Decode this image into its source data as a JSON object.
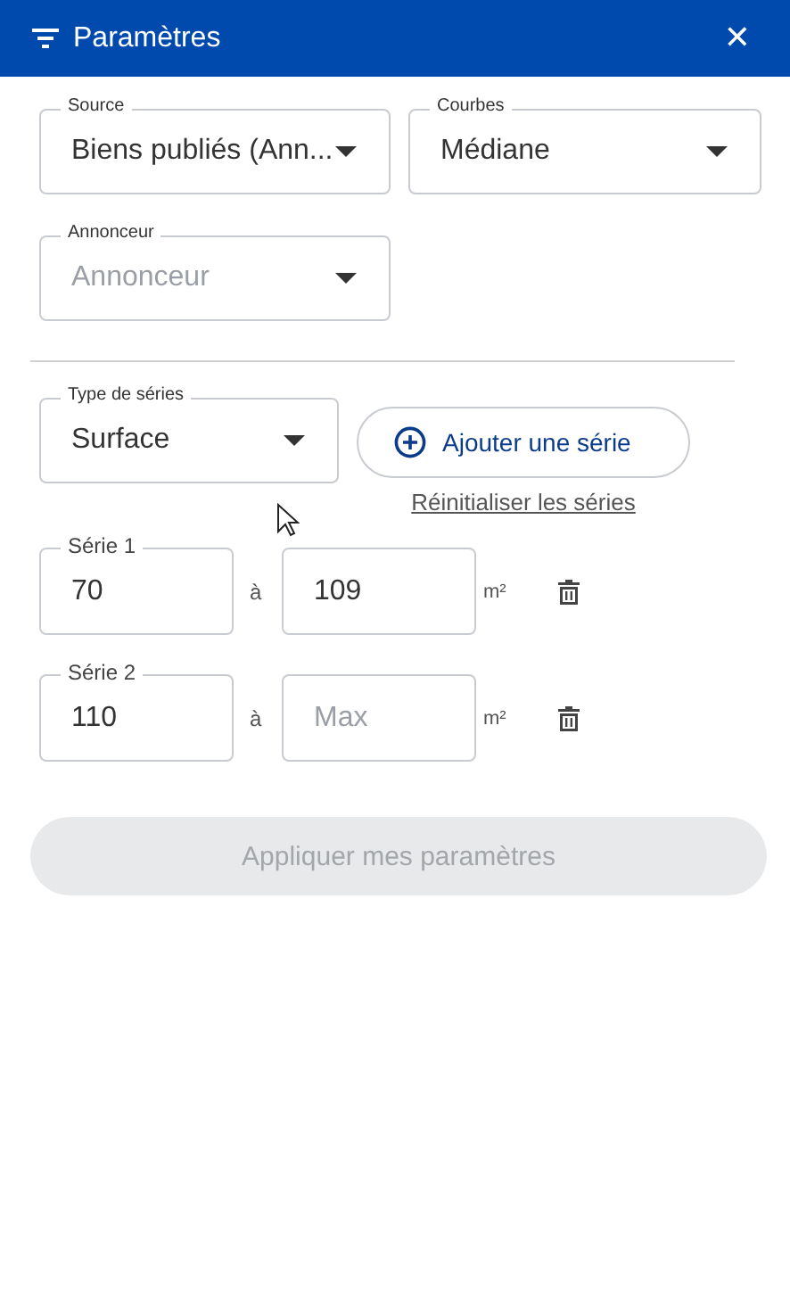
{
  "header": {
    "title": "Paramètres",
    "close": "✕"
  },
  "selects": [
    {
      "label": "Source",
      "value": "Biens publiés (Ann..."
    },
    {
      "label": "Courbes",
      "value": "Médiane"
    },
    {
      "label": "Annonceur",
      "placeholder": "Annonceur"
    }
  ],
  "series_type": {
    "label": "Type de séries",
    "value": "Surface"
  },
  "add_button": "Ajouter une série",
  "reset_link": "Réinitialiser les séries",
  "series": [
    {
      "label": "Série 1",
      "min": {
        "value": "70"
      },
      "separator": "à",
      "max": {
        "value": "109"
      },
      "unit": "m²"
    },
    {
      "label": "Série 2",
      "min": {
        "value": "110"
      },
      "separator": "à",
      "max": {
        "placeholder": "Max"
      },
      "unit": "m²"
    }
  ],
  "apply_button": {
    "label": "Appliquer mes paramètres",
    "disabled": true
  }
}
